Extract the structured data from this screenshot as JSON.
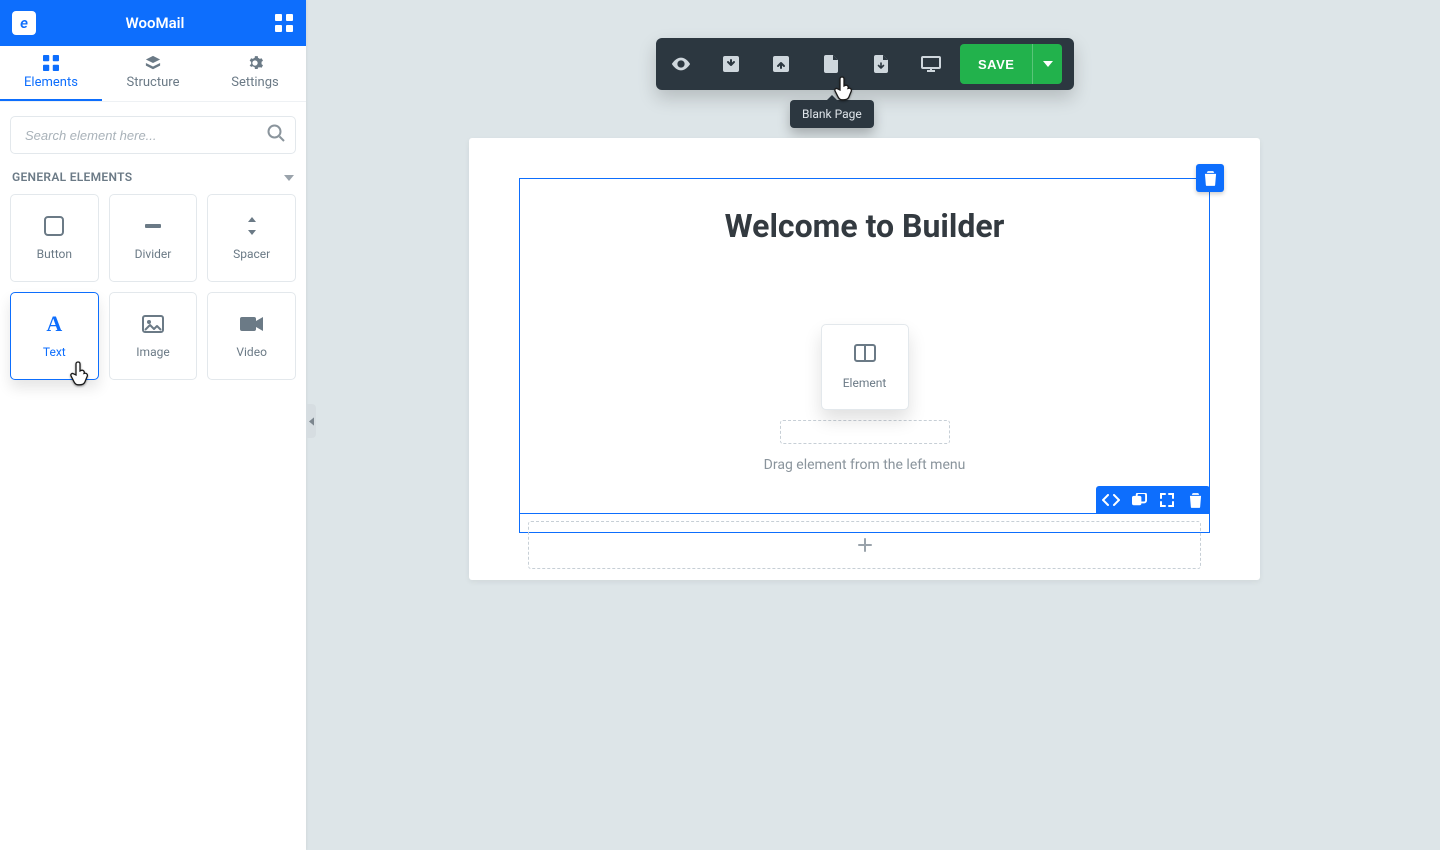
{
  "app": {
    "name": "WooMail"
  },
  "sidebar": {
    "tabs": [
      {
        "label": "Elements",
        "active": true
      },
      {
        "label": "Structure",
        "active": false
      },
      {
        "label": "Settings",
        "active": false
      }
    ],
    "search": {
      "placeholder": "Search element here..."
    },
    "groups": [
      {
        "title": "GENERAL ELEMENTS",
        "items": [
          {
            "label": "Button",
            "icon": "square"
          },
          {
            "label": "Divider",
            "icon": "minus"
          },
          {
            "label": "Spacer",
            "icon": "spacer"
          },
          {
            "label": "Text",
            "icon": "text",
            "active": true
          },
          {
            "label": "Image",
            "icon": "image"
          },
          {
            "label": "Video",
            "icon": "video"
          }
        ]
      }
    ]
  },
  "toolbar": {
    "buttons": [
      {
        "name": "preview",
        "icon": "eye"
      },
      {
        "name": "import",
        "icon": "box-down"
      },
      {
        "name": "export",
        "icon": "box-up"
      },
      {
        "name": "blank-page",
        "icon": "file"
      },
      {
        "name": "template",
        "icon": "file-down"
      },
      {
        "name": "desktop",
        "icon": "monitor"
      }
    ],
    "save_label": "SAVE",
    "tooltip": "Blank Page"
  },
  "canvas": {
    "heading": "Welcome to Builder",
    "drop_card_label": "Element",
    "drag_hint": "Drag element from the left menu"
  },
  "colors": {
    "primary": "#0d6efd",
    "toolbar_bg": "#2c3740",
    "save_bg": "#22b24c",
    "page_bg": "#dde5e8"
  }
}
